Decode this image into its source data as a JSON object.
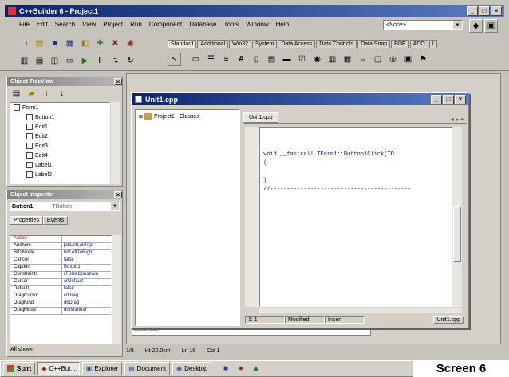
{
  "app_title": "C++Builder 6 - Project1",
  "menu": [
    "File",
    "Edit",
    "Search",
    "View",
    "Project",
    "Run",
    "Component",
    "Database",
    "Tools",
    "Window",
    "Help"
  ],
  "config_combo": "<None>",
  "palette_tabs": [
    "Standard",
    "Additional",
    "Win32",
    "System",
    "Data Access",
    "Data Controls",
    "Data Snap",
    "BDE",
    "ADO",
    "I"
  ],
  "tree_title": "Object TreeView",
  "tree_items": [
    "Form1",
    "Button1",
    "Edit1",
    "Edit2",
    "Edit3",
    "Edit4",
    "Label1",
    "Label2"
  ],
  "inspector": {
    "title": "Object Inspector",
    "selected": "Button1",
    "selected_type": "TButton",
    "tabs": [
      "Properties",
      "Events"
    ],
    "rows": [
      {
        "k": "Action",
        "v": ""
      },
      {
        "k": "Anchors",
        "v": "[akLeft,akTop]"
      },
      {
        "k": "BiDiMode",
        "v": "bdLeftToRight"
      },
      {
        "k": "Cancel",
        "v": "false"
      },
      {
        "k": "Caption",
        "v": "Button1"
      },
      {
        "k": "Constraints",
        "v": "(TSizeConstrain"
      },
      {
        "k": "Cursor",
        "v": "crDefault"
      },
      {
        "k": "Default",
        "v": "false"
      },
      {
        "k": "DragCursor",
        "v": "crDrag"
      },
      {
        "k": "DragKind",
        "v": "dkDrag"
      },
      {
        "k": "DragMode",
        "v": "dmManual"
      }
    ],
    "footer": "All shown"
  },
  "editor": {
    "title": "Unit1.cpp",
    "tab": "Unit1.cpp",
    "explorer_item": "Project1 - Classes",
    "code_lines": [
      "void __fastcall TForm1::Button1Click(TO",
      "{",
      "",
      "}",
      "//------------------------------------------"
    ],
    "status": [
      "1:  1",
      "Modified",
      "Insert"
    ],
    "status_tab": "Unit1.cpp"
  },
  "bg_status": [
    "1/8",
    "Ht 20.0cm",
    "Ln 16",
    "Col 1"
  ],
  "taskbar": [
    "Start",
    "C++Bui...",
    "Explorer",
    "Document",
    "Desktop"
  ],
  "screen_label": "Screen 6"
}
